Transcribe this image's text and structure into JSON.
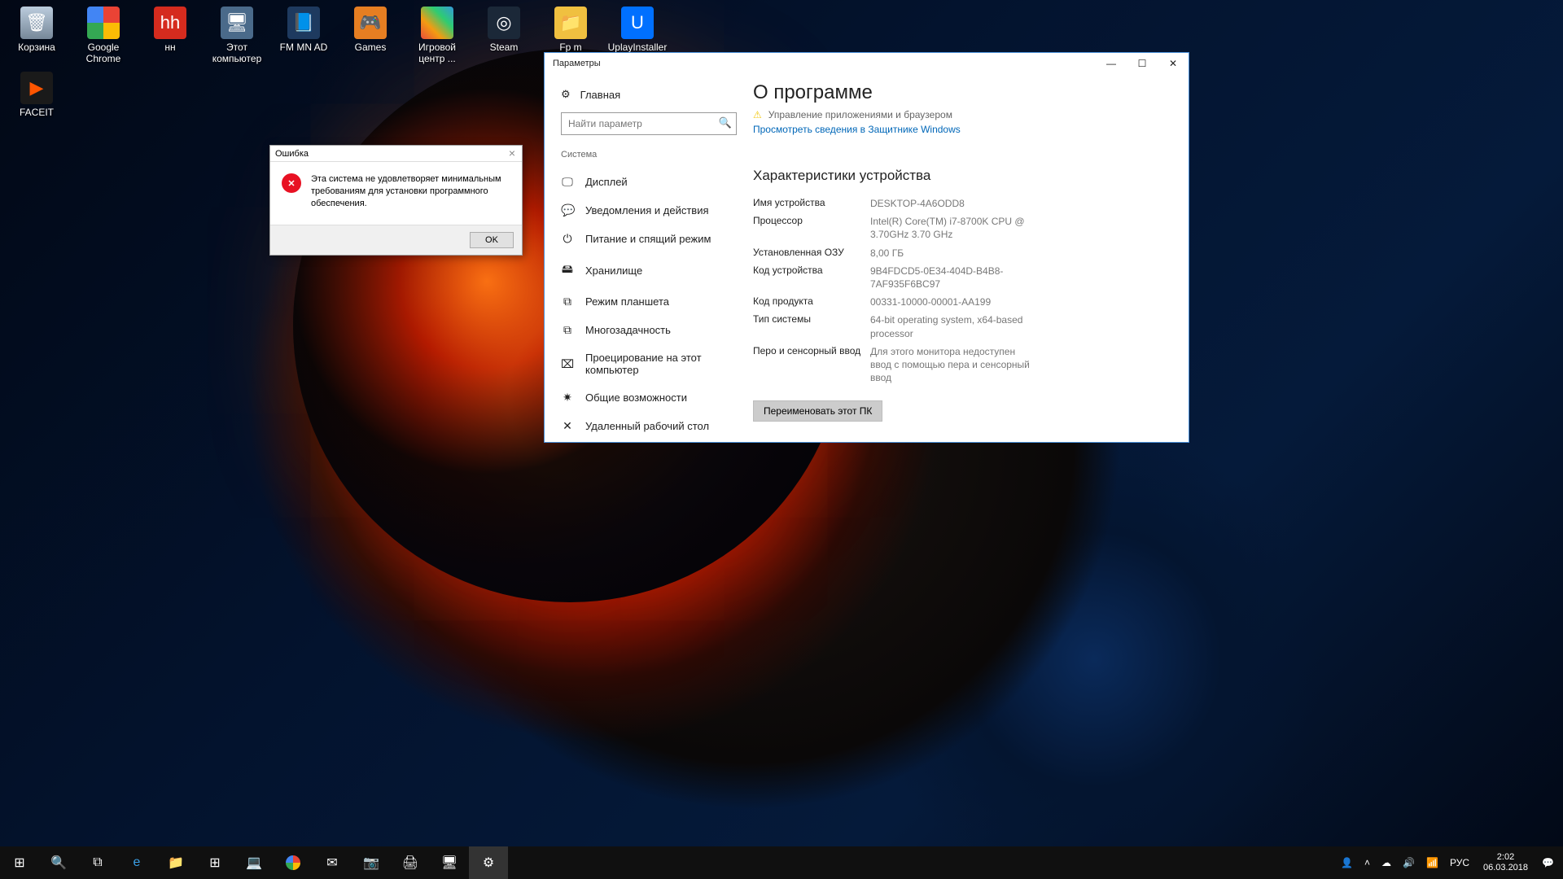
{
  "desktop_icons": [
    {
      "label": "Корзина"
    },
    {
      "label": "Google Chrome"
    },
    {
      "label": "нн"
    },
    {
      "label": "Этот компьютер"
    },
    {
      "label": "FM MN AD"
    },
    {
      "label": "Games"
    },
    {
      "label": "Игровой центр ..."
    },
    {
      "label": "Steam"
    },
    {
      "label": "Fp m"
    },
    {
      "label": "UplayInstaller"
    }
  ],
  "desktop_row2": {
    "label": "FACEIT"
  },
  "error": {
    "title": "Ошибка",
    "message": "Эта система не удовлетворяет минимальным требованиям для установки программного обеспечения.",
    "ok": "OK"
  },
  "settings": {
    "window_title": "Параметры",
    "home": "Главная",
    "search_placeholder": "Найти параметр",
    "section": "Система",
    "nav": [
      {
        "icon": "🖵",
        "label": "Дисплей"
      },
      {
        "icon": "💬",
        "label": "Уведомления и действия"
      },
      {
        "icon": "⏻",
        "label": "Питание и спящий режим"
      },
      {
        "icon": "🖴",
        "label": "Хранилище"
      },
      {
        "icon": "⧉",
        "label": "Режим планшета"
      },
      {
        "icon": "⧉",
        "label": "Многозадачность"
      },
      {
        "icon": "⌧",
        "label": "Проецирование на этот компьютер"
      },
      {
        "icon": "✷",
        "label": "Общие возможности"
      },
      {
        "icon": "✕",
        "label": "Удаленный рабочий стол"
      }
    ],
    "page_title": "О программе",
    "warn_text": "Управление приложениями и браузером",
    "defender_link": "Просмотреть сведения в Защитнике Windows",
    "specs_header": "Характеристики устройства",
    "specs": [
      {
        "k": "Имя устройства",
        "v": "DESKTOP-4A6ODD8"
      },
      {
        "k": "Процессор",
        "v": "Intel(R) Core(TM) i7-8700K CPU @ 3.70GHz   3.70 GHz"
      },
      {
        "k": "Установленная ОЗУ",
        "v": "8,00 ГБ"
      },
      {
        "k": "Код устройства",
        "v": "9B4FDCD5-0E34-404D-B4B8-7AF935F6BC97"
      },
      {
        "k": "Код продукта",
        "v": "00331-10000-00001-AA199"
      },
      {
        "k": "Тип системы",
        "v": "64-bit operating system, x64-based processor"
      },
      {
        "k": "Перо и сенсорный ввод",
        "v": "Для этого монитора недоступен ввод с помощью пера и сенсорный ввод"
      }
    ],
    "rename": "Переименовать этот ПК"
  },
  "taskbar": {
    "lang": "РУС",
    "time": "2:02",
    "date": "06.03.2018"
  }
}
